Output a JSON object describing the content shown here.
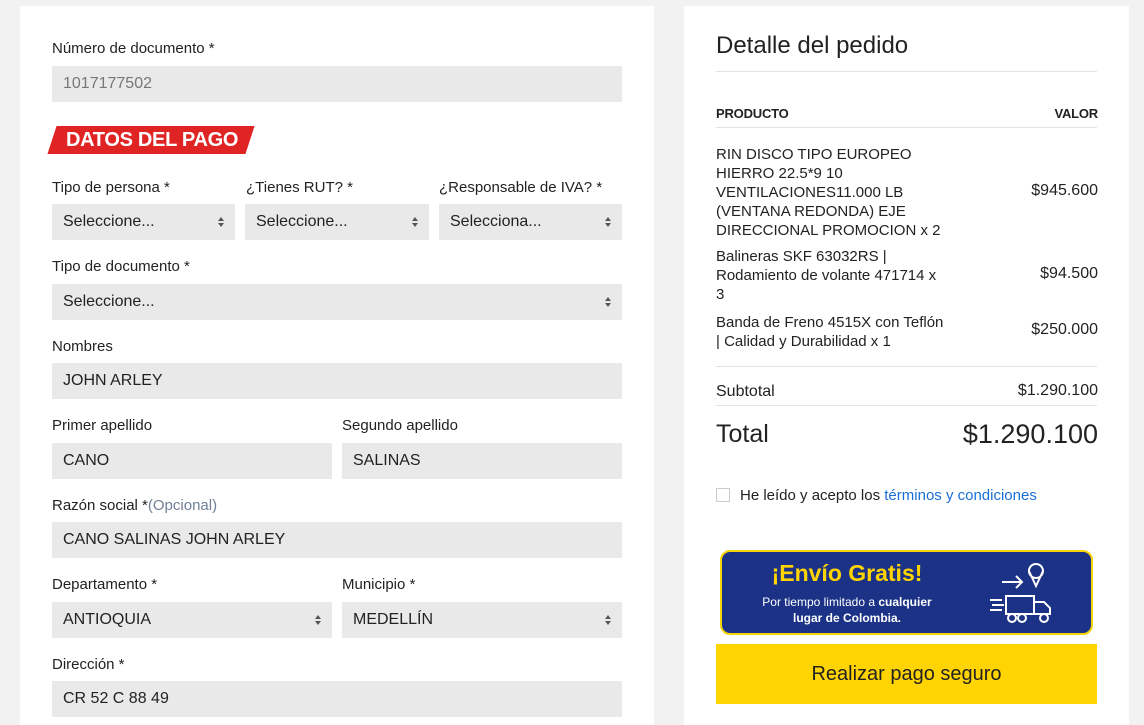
{
  "form": {
    "doc_number": {
      "label": "Número de documento *",
      "value": "1017177502"
    },
    "section_title": "DATOS DEL PAGO",
    "tipo_persona": {
      "label": "Tipo de persona *",
      "value": "Seleccione..."
    },
    "tienes_rut": {
      "label": "¿Tienes RUT? *",
      "value": "Seleccione..."
    },
    "responsable_iva": {
      "label": "¿Responsable de IVA? *",
      "value": "Selecciona..."
    },
    "tipo_documento": {
      "label": "Tipo de documento *",
      "value": "Seleccione..."
    },
    "nombres": {
      "label": "Nombres",
      "value": "JOHN ARLEY"
    },
    "primer_apellido": {
      "label": "Primer apellido",
      "value": "CANO"
    },
    "segundo_apellido": {
      "label": "Segundo apellido",
      "value": "SALINAS"
    },
    "razon_social": {
      "label": "Razón social *",
      "optional": "(Opcional)",
      "value": "CANO SALINAS JOHN ARLEY"
    },
    "departamento": {
      "label": "Departamento *",
      "value": "ANTIOQUIA"
    },
    "municipio": {
      "label": "Municipio *",
      "value": "MEDELLÍN"
    },
    "direccion": {
      "label": "Dirección *",
      "value": "CR 52 C 88 49"
    }
  },
  "order": {
    "title": "Detalle del pedido",
    "col_product": "PRODUCTO",
    "col_value": "VALOR",
    "items": [
      {
        "name": "RIN DISCO TIPO EUROPEO HIERRO 22.5*9 10 VENTILACIONES11.000 LB (VENTANA REDONDA) EJE DIRECCIONAL PROMOCION x 2",
        "price": "$945.600"
      },
      {
        "name": "Balineras SKF 63032RS | Rodamiento de volante 471714 x 3",
        "price": "$94.500"
      },
      {
        "name": "Banda de Freno 4515X con Teflón | Calidad y Durabilidad x 1",
        "price": "$250.000"
      }
    ],
    "subtotal_label": "Subtotal",
    "subtotal_value": "$1.290.100",
    "total_label": "Total",
    "total_value": "$1.290.100",
    "terms_prefix": "He leído y acepto los ",
    "terms_link": "términos y condiciones",
    "promo_title": "¡Envío Gratis!",
    "promo_line1_a": "Por tiempo limitado a ",
    "promo_line1_b": "cualquier",
    "promo_line2": "lugar de Colombia.",
    "pay_button": "Realizar pago seguro"
  },
  "colors": {
    "accent_red": "#e02424",
    "pay_yellow": "#ffd400",
    "promo_blue": "#1b3286",
    "link_blue": "#1a6fd6"
  }
}
